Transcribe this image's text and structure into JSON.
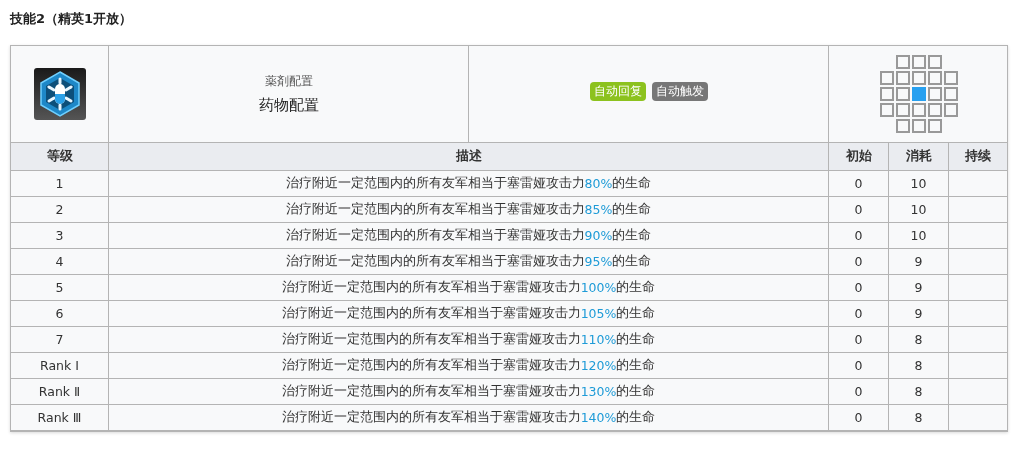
{
  "section_title": "技能2（精英1开放）",
  "skill": {
    "name_original": "薬剤配置",
    "name": "药物配置",
    "tags": [
      {
        "label": "自动回复",
        "color": "#8cc21e"
      },
      {
        "label": "自动触发",
        "color": "#777777"
      }
    ],
    "range": [
      {
        "cells": [
          {
            "kind": "none"
          },
          {
            "kind": "tile"
          },
          {
            "kind": "tile"
          },
          {
            "kind": "tile"
          },
          {
            "kind": "none"
          }
        ]
      },
      {
        "cells": [
          {
            "kind": "tile"
          },
          {
            "kind": "tile"
          },
          {
            "kind": "tile"
          },
          {
            "kind": "tile"
          },
          {
            "kind": "tile"
          }
        ]
      },
      {
        "cells": [
          {
            "kind": "tile"
          },
          {
            "kind": "tile"
          },
          {
            "kind": "self"
          },
          {
            "kind": "tile"
          },
          {
            "kind": "tile"
          }
        ]
      },
      {
        "cells": [
          {
            "kind": "tile"
          },
          {
            "kind": "tile"
          },
          {
            "kind": "tile"
          },
          {
            "kind": "tile"
          },
          {
            "kind": "tile"
          }
        ]
      },
      {
        "cells": [
          {
            "kind": "none"
          },
          {
            "kind": "tile"
          },
          {
            "kind": "tile"
          },
          {
            "kind": "tile"
          },
          {
            "kind": "none"
          }
        ]
      }
    ]
  },
  "table": {
    "columns": [
      "等级",
      "描述",
      "初始",
      "消耗",
      "持续"
    ],
    "rows": [
      {
        "level": "1",
        "desc_before": "治疗附近一定范围内的所有友军相当于塞雷娅攻击力",
        "desc_value": "80%",
        "desc_after": "的生命",
        "initial": "0",
        "cost": "10"
      },
      {
        "level": "2",
        "desc_before": "治疗附近一定范围内的所有友军相当于塞雷娅攻击力",
        "desc_value": "85%",
        "desc_after": "的生命",
        "initial": "0",
        "cost": "10"
      },
      {
        "level": "3",
        "desc_before": "治疗附近一定范围内的所有友军相当于塞雷娅攻击力",
        "desc_value": "90%",
        "desc_after": "的生命",
        "initial": "0",
        "cost": "10"
      },
      {
        "level": "4",
        "desc_before": "治疗附近一定范围内的所有友军相当于塞雷娅攻击力",
        "desc_value": "95%",
        "desc_after": "的生命",
        "initial": "0",
        "cost": "9"
      },
      {
        "level": "5",
        "desc_before": "治疗附近一定范围内的所有友军相当于塞雷娅攻击力",
        "desc_value": "100%",
        "desc_after": "的生命",
        "initial": "0",
        "cost": "9"
      },
      {
        "level": "6",
        "desc_before": "治疗附近一定范围内的所有友军相当于塞雷娅攻击力",
        "desc_value": "105%",
        "desc_after": "的生命",
        "initial": "0",
        "cost": "9"
      },
      {
        "level": "7",
        "desc_before": "治疗附近一定范围内的所有友军相当于塞雷娅攻击力",
        "desc_value": "110%",
        "desc_after": "的生命",
        "initial": "0",
        "cost": "8"
      },
      {
        "level": "Rank Ⅰ",
        "desc_before": "治疗附近一定范围内的所有友军相当于塞雷娅攻击力",
        "desc_value": "120%",
        "desc_after": "的生命",
        "initial": "0",
        "cost": "8"
      },
      {
        "level": "Rank Ⅱ",
        "desc_before": "治疗附近一定范围内的所有友军相当于塞雷娅攻击力",
        "desc_value": "130%",
        "desc_after": "的生命",
        "initial": "0",
        "cost": "8"
      },
      {
        "level": "Rank Ⅲ",
        "desc_before": "治疗附近一定范围内的所有友军相当于塞雷娅攻击力",
        "desc_value": "140%",
        "desc_after": "的生命",
        "initial": "0",
        "cost": "8"
      }
    ]
  }
}
